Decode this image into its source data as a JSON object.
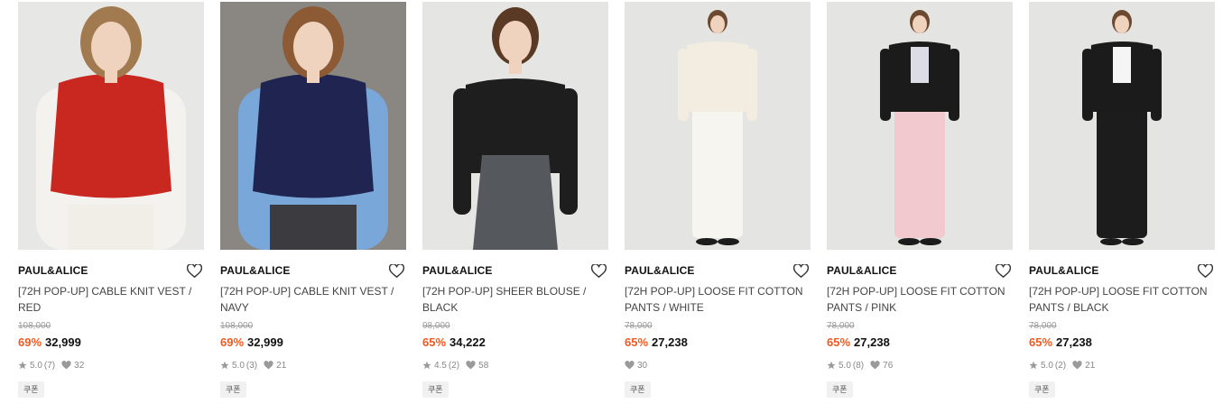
{
  "products": [
    {
      "brand": "PAUL&ALICE",
      "title": "[72H POP-UP] CABLE KNIT VEST / RED",
      "original_price": "108,000",
      "discount": "69%",
      "price": "32,999",
      "rating": "5.0",
      "reviews": "(7)",
      "likes": "32",
      "coupon": "쿠폰",
      "bg": "#e7e7e5",
      "top": "#c8281f",
      "under": "#f4f2ee",
      "bottom": "#f1eee8",
      "hair": "#a27a4f"
    },
    {
      "brand": "PAUL&ALICE",
      "title": "[72H POP-UP] CABLE KNIT VEST / NAVY",
      "original_price": "108,000",
      "discount": "69%",
      "price": "32,999",
      "rating": "5.0",
      "reviews": "(3)",
      "likes": "21",
      "coupon": "쿠폰",
      "bg": "#8a8782",
      "top": "#1f2550",
      "under": "#7aa7d9",
      "bottom": "#3c3c40",
      "hair": "#8c5a34"
    },
    {
      "brand": "PAUL&ALICE",
      "title": "[72H POP-UP] SHEER BLOUSE / BLACK",
      "original_price": "98,000",
      "discount": "65%",
      "price": "34,222",
      "rating": "4.5",
      "reviews": "(2)",
      "likes": "58",
      "coupon": "쿠폰",
      "bg": "#e5e5e3",
      "top": "#1e1e1e",
      "under": "#1e1e1e",
      "bottom": "#55585c",
      "hair": "#5a3a24"
    },
    {
      "brand": "PAUL&ALICE",
      "title": "[72H POP-UP] LOOSE FIT COTTON PANTS / WHITE",
      "original_price": "78,000",
      "discount": "65%",
      "price": "27,238",
      "rating": "",
      "reviews": "",
      "likes": "30",
      "coupon": "쿠폰",
      "bg": "#e4e4e2",
      "top": "#f3ede1",
      "under": "#f3ede1",
      "bottom": "#f7f5ef",
      "hair": "#6b4a30"
    },
    {
      "brand": "PAUL&ALICE",
      "title": "[72H POP-UP] LOOSE FIT COTTON PANTS / PINK",
      "original_price": "78,000",
      "discount": "65%",
      "price": "27,238",
      "rating": "5.0",
      "reviews": "(8)",
      "likes": "76",
      "coupon": "쿠폰",
      "bg": "#e4e4e2",
      "top": "#1b1b1b",
      "under": "#dcdce6",
      "bottom": "#f1c9cf",
      "hair": "#6b4a30"
    },
    {
      "brand": "PAUL&ALICE",
      "title": "[72H POP-UP] LOOSE FIT COTTON PANTS / BLACK",
      "original_price": "78,000",
      "discount": "65%",
      "price": "27,238",
      "rating": "5.0",
      "reviews": "(2)",
      "likes": "21",
      "coupon": "쿠폰",
      "bg": "#e4e4e2",
      "top": "#1b1b1b",
      "under": "#f5f5f5",
      "bottom": "#1c1c1c",
      "hair": "#6b4a30"
    }
  ],
  "colors": {
    "discount": "#f05a22",
    "meta": "#888888"
  },
  "icons": {
    "wishlist": "heart-outline-icon",
    "rating": "star-icon",
    "likes": "heart-filled-icon"
  }
}
